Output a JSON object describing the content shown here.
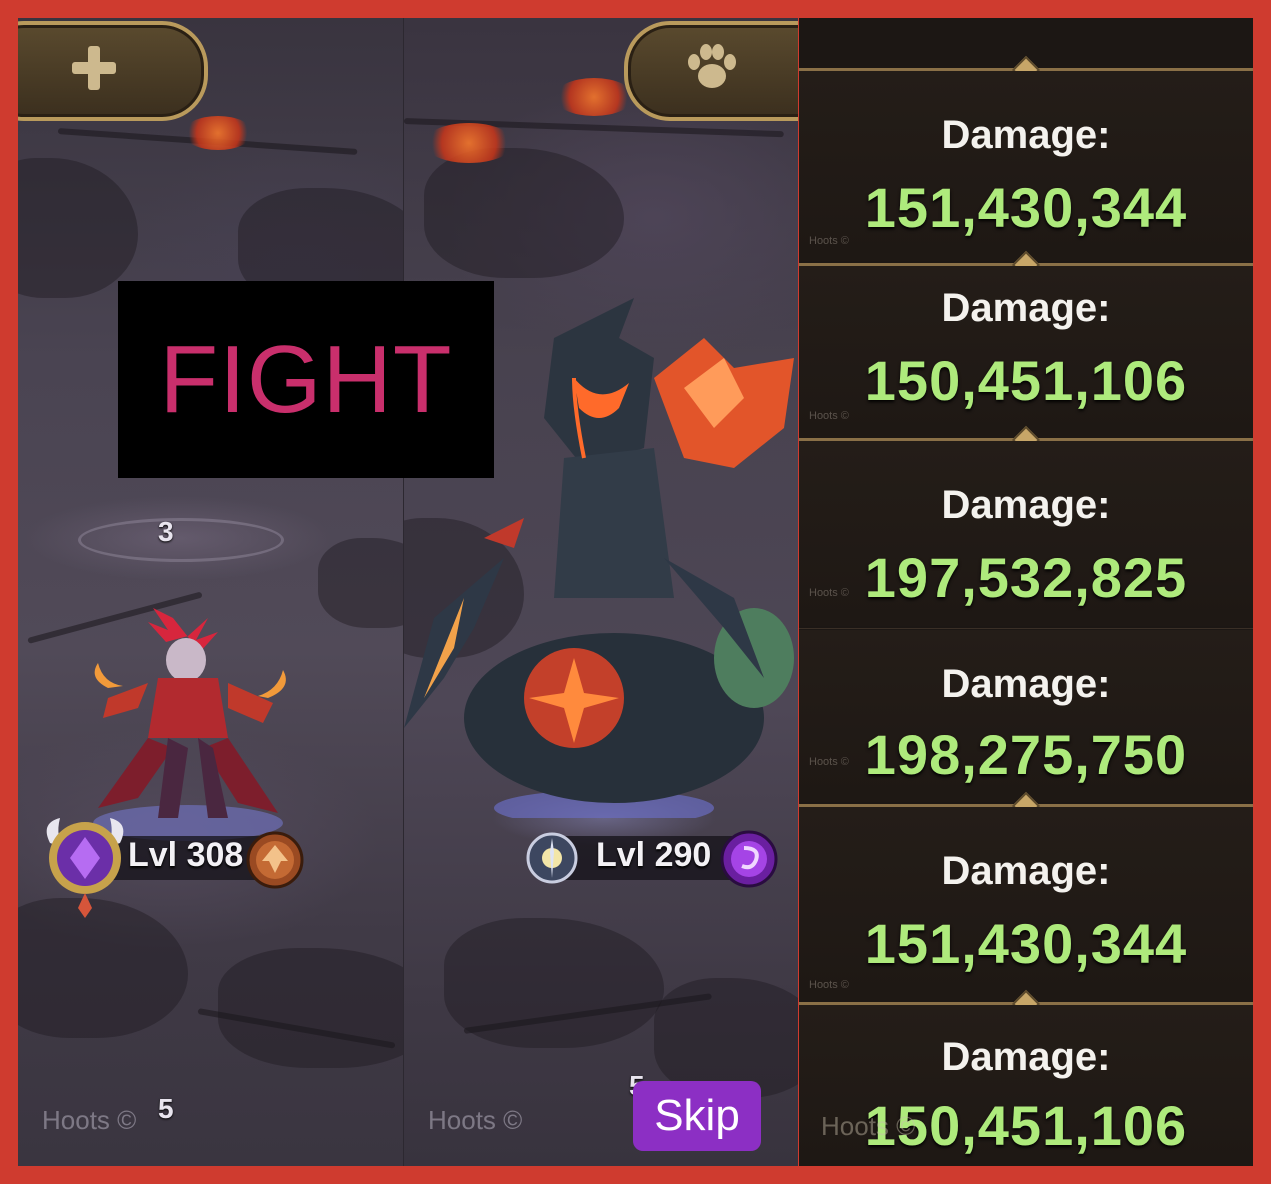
{
  "overlay": {
    "fight_label": "FIGHT"
  },
  "left_panel": {
    "slot_top": "3",
    "slot_bottom": "5",
    "hero_level": "Lvl 308",
    "watermark": "Hoots ©"
  },
  "mid_panel": {
    "slot_bottom": "5",
    "boss_level": "Lvl 290",
    "watermark": "Hoots ©",
    "skip_label": "Skip"
  },
  "damage_panel": {
    "watermark": "Hoots ©",
    "entries": [
      {
        "label": "Damage:",
        "value": "151,430,344"
      },
      {
        "label": "Damage:",
        "value": "150,451,106"
      },
      {
        "label": "Damage:",
        "value": "197,532,825"
      },
      {
        "label": "Damage:",
        "value": "198,275,750"
      },
      {
        "label": "Damage:",
        "value": "151,430,344"
      },
      {
        "label": "Damage:",
        "value": "150,451,106"
      }
    ],
    "bottom_watermark": "Hoots ©"
  },
  "icons": [
    "plus-icon",
    "paw-icon",
    "faction-badge-icon",
    "class-emblem-icon",
    "celestial-badge-icon",
    "hypogean-emblem-icon"
  ],
  "colors": {
    "frame": "#cf3b2f",
    "fight_text": "#c92f6c",
    "damage_value": "#aeea7c",
    "skip_button": "#8c2fc4"
  }
}
